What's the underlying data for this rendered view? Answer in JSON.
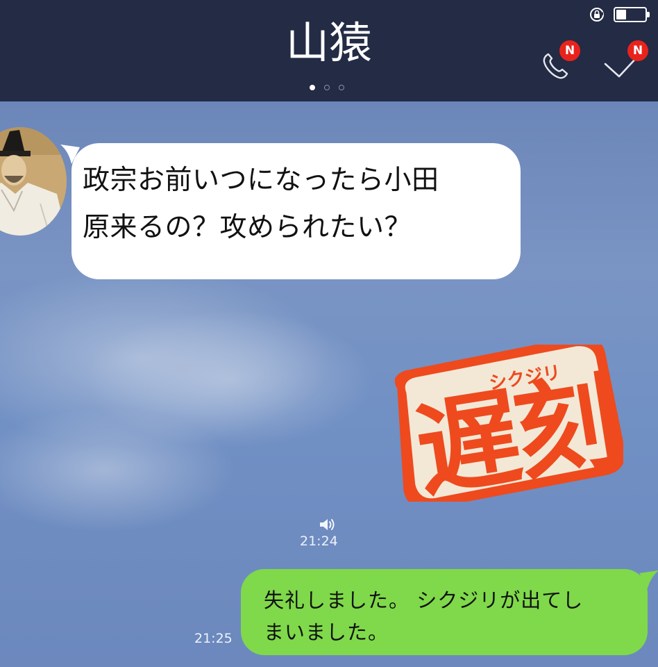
{
  "header": {
    "title": "山猿",
    "status_icons": [
      "lock-rotation-icon",
      "battery-icon"
    ],
    "call_badge": "N",
    "check_badge": "N",
    "page_dots": {
      "count": 3,
      "active": 1
    },
    "colors": {
      "background": "#232b45",
      "badge": "#e8231c"
    }
  },
  "messages": [
    {
      "direction": "incoming",
      "lines": [
        "政宗お前いつになったら小田",
        "原来るの？攻められたい？"
      ],
      "avatar": "samurai-portrait"
    },
    {
      "direction": "incoming",
      "type": "sticker",
      "sticker": {
        "main": "遅刻",
        "ruby": "シクジリ"
      },
      "voice_icon": "speaker-icon",
      "time": "21:24"
    },
    {
      "direction": "outgoing",
      "lines": [
        "失礼しました。 シクジリが出てし",
        "まいました。"
      ],
      "time": "21:25"
    }
  ],
  "colors": {
    "chat_background": "#7190c4",
    "incoming_bubble": "#ffffff",
    "outgoing_bubble": "#7fd94a",
    "sticker_red": "#ee4a1e",
    "sticker_paper": "#f3e8d6"
  }
}
